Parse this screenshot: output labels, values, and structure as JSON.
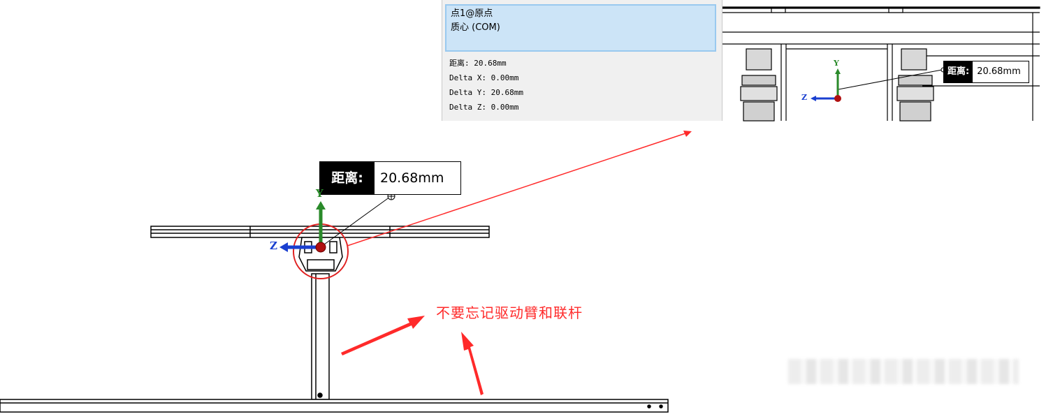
{
  "selection_panel": {
    "items": [
      "点1@原点",
      "质心 (COM)"
    ],
    "measurements": [
      "距离: 20.68mm",
      "Delta X: 0.00mm",
      "Delta Y: 20.68mm",
      "Delta Z: 0.00mm"
    ]
  },
  "inset_view": {
    "callout_key": "距离:",
    "callout_value": "20.68mm",
    "axis_y": "Y",
    "axis_z": "Z"
  },
  "main_view": {
    "callout_key": "距离:",
    "callout_value": "20.68mm",
    "axis_y": "Y",
    "axis_z": "Z"
  },
  "annotation": {
    "note": "不要忘记驱动臂和联杆",
    "color": "#ff2a2a"
  }
}
